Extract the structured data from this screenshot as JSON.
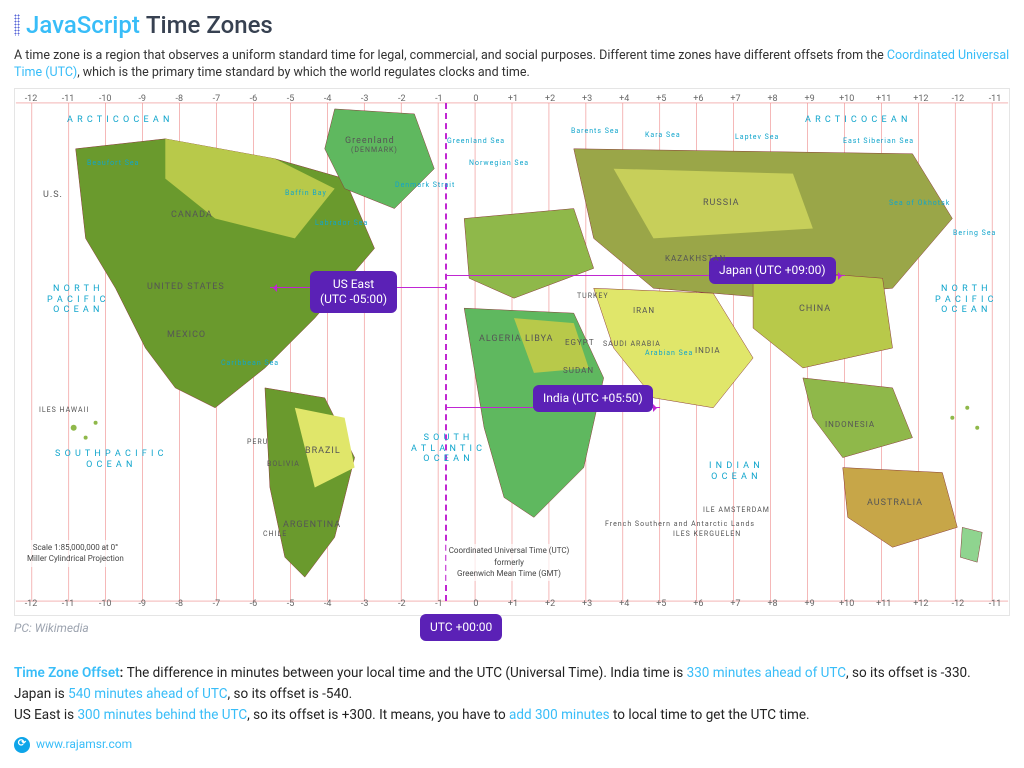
{
  "title": {
    "prefix": "JavaScript",
    "suffix": "Time Zones"
  },
  "intro": {
    "pre": "A time zone is a region that observes a uniform standard time for legal, commercial, and social purposes. Different time zones have different offsets from the ",
    "link": "Coordinated Universal Time (UTC)",
    "post": ", which is the primary time standard by which the world regulates clocks and time."
  },
  "tz_axis": [
    "-12",
    "-11",
    "-10",
    "-9",
    "-8",
    "-7",
    "-6",
    "-5",
    "-4",
    "-3",
    "-2",
    "-1",
    "0",
    "+1",
    "+2",
    "+3",
    "+4",
    "+5",
    "+6",
    "+7",
    "+8",
    "+9",
    "+10",
    "+11",
    "+12",
    "-12",
    "-11"
  ],
  "callouts": {
    "us_east": {
      "line1": "US East",
      "line2": "(UTC -05:00)"
    },
    "india": {
      "label": "India (UTC +05:50)"
    },
    "japan": {
      "label": "Japan (UTC +09:00)"
    },
    "utc": {
      "label": "UTC +00:00"
    }
  },
  "ocean_labels": {
    "arctic1": "A R C T I C O C E A N",
    "arctic2": "A R C T I C O C E A N",
    "north_pacific1": "N O R T H\nP A C I F I C\nO C E A N",
    "north_pacific2": "N O R T H\nP A C I F I C\nO C E A N",
    "south_pacific": "S O U T H P A C I F I C\nO C E A N",
    "south_atlantic": "S O U T H\nA T L A N T I C\nO C E A N",
    "indian": "I N D I A N\nO C E A N"
  },
  "sea_labels": {
    "beaufort": "Beaufort Sea",
    "baffin": "Baffin Bay",
    "labrador": "Labrador Sea",
    "greenland_sea": "Greenland Sea",
    "norwegian": "Norwegian Sea",
    "denmark": "Denmark Strait",
    "barents": "Barents Sea",
    "kara": "Kara Sea",
    "laptev": "Laptev Sea",
    "east_siberian": "East Siberian Sea",
    "bering": "Bering Sea",
    "okhotsk": "Sea of Okhotsk",
    "caribbean": "Caribbean Sea",
    "arabian": "Arabian Sea"
  },
  "country_labels": {
    "us": "U.S.",
    "canada": "CANADA",
    "united_states": "UNITED STATES",
    "greenland": "Greenland",
    "greenland_sub": "(DENMARK)",
    "mexico": "MEXICO",
    "brazil": "BRAZIL",
    "argentina": "ARGENTINA",
    "bolivia": "BOLIVIA",
    "peru": "PERU",
    "chile": "CHILE",
    "algeria": "ALGERIA",
    "libya": "LIBYA",
    "egypt": "EGYPT",
    "sudan": "SUDAN",
    "saudi": "SAUDI ARABIA",
    "iran": "IRAN",
    "turkey": "TURKEY",
    "russia": "RUSSIA",
    "kazakhstan": "KAZAKHSTAN",
    "china": "CHINA",
    "india": "INDIA",
    "indonesia": "INDONESIA",
    "australia": "AUSTRALIA",
    "iles_hawaii": "ILES HAWAII",
    "kerguelen": "ILES KERGUELEN",
    "amsterdam": "ILE AMSTERDAM",
    "fsat": "French Southern and Antarctic Lands"
  },
  "scale": {
    "line1": "Scale 1:85,000,000 at 0°",
    "line2": "Miller Cylindrical Projection"
  },
  "utc_caption": {
    "line1": "Coordinated Universal Time (UTC)",
    "line2": "formerly",
    "line3": "Greenwich Mean Time (GMT)"
  },
  "credit": "PC: Wikimedia",
  "offset_paragraph": {
    "label": "Time Zone Offset",
    "colon": ": ",
    "p1a": "The difference in minutes between your local time and the UTC (Universal Time). India time is ",
    "p1_link1": "330 minutes ahead of UTC",
    "p1b": ", so its offset is -330. Japan is ",
    "p1_link2": "540 minutes ahead of UTC",
    "p1c": ", so its offset is -540.",
    "p2a": "US East is ",
    "p2_link1": "300 minutes behind the UTC",
    "p2b": ", so its offset is +300. It means, you have to ",
    "p2_link2": "add 300 minutes",
    "p2c": " to local time to get the UTC time."
  },
  "footer_url": "www.rajamsr.com",
  "colors": {
    "link": "#38bdf8",
    "callout_bg": "#5b21b6",
    "arrow": "#c026d3"
  }
}
